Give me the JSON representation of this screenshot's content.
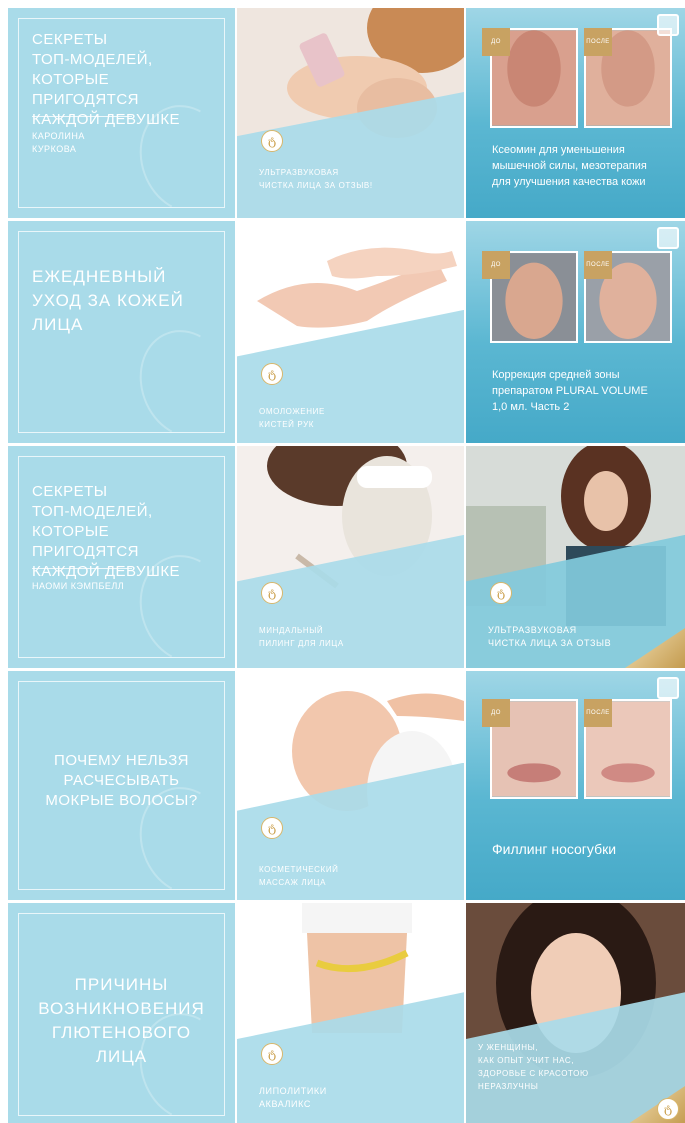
{
  "tiles": {
    "t00": {
      "headline_lines": [
        "СЕКРЕТЫ",
        "ТОП-МОДЕЛЕЙ,",
        "КОТОРЫЕ ПРИГОДЯТСЯ",
        "КАЖДОЙ ДЕВУШКЕ"
      ],
      "caption_lines": [
        "КАРОЛИНА",
        "КУРКОВА"
      ]
    },
    "t01": {
      "caption_lines": [
        "УЛЬТРАЗВУКОВАЯ",
        "ЧИСТКА ЛИЦА ЗА ОТЗЫВ!"
      ]
    },
    "t02": {
      "before": "ДО",
      "after": "ПОСЛЕ",
      "text_lines": [
        "Ксеомин для уменьшения",
        "мышечной силы, мезотерапия",
        "для улучшения качества кожи"
      ]
    },
    "t10": {
      "headline_lines": [
        "ЕЖЕДНЕВНЫЙ",
        "УХОД ЗА КОЖЕЙ",
        "ЛИЦА"
      ]
    },
    "t11": {
      "caption_lines": [
        "ОМОЛОЖЕНИЕ",
        "КИСТЕЙ РУК"
      ]
    },
    "t12": {
      "before": "ДО",
      "after": "ПОСЛЕ",
      "text_lines": [
        "Коррекция средней зоны",
        "препаратом PLURAL VOLUME",
        "1,0 мл. Часть 2"
      ]
    },
    "t20": {
      "headline_lines": [
        "СЕКРЕТЫ",
        "ТОП-МОДЕЛЕЙ,",
        "КОТОРЫЕ ПРИГОДЯТСЯ",
        "КАЖДОЙ ДЕВУШКЕ"
      ],
      "caption_lines": [
        "НАОМИ КЭМПБЕЛЛ"
      ]
    },
    "t21": {
      "caption_lines": [
        "МИНДАЛЬНЫЙ",
        "ПИЛИНГ ДЛЯ ЛИЦА"
      ]
    },
    "t22": {
      "caption_lines": [
        "УЛЬТРАЗВУКОВАЯ",
        "ЧИСТКА ЛИЦА ЗА ОТЗЫВ"
      ]
    },
    "t30": {
      "headline_lines": [
        "ПОЧЕМУ НЕЛЬЗЯ",
        "РАСЧЕСЫВАТЬ",
        "МОКРЫЕ ВОЛОСЫ?"
      ]
    },
    "t31": {
      "caption_lines": [
        "КОСМЕТИЧЕСКИЙ",
        "МАССАЖ ЛИЦА"
      ]
    },
    "t32": {
      "before": "ДО",
      "after": "ПОСЛЕ",
      "text_lines": [
        "Филлинг носогубки"
      ]
    },
    "t40": {
      "headline_lines": [
        "ПРИЧИНЫ",
        "ВОЗНИКНОВЕНИЯ",
        "ГЛЮТЕНОВОГО",
        "ЛИЦА"
      ]
    },
    "t41": {
      "caption_lines": [
        "ЛИПОЛИТИКИ",
        "АКВАЛИКС"
      ]
    },
    "t42": {
      "caption_lines": [
        "У ЖЕНЩИНЫ,",
        "КАК ОПЫТ УЧИТ НАС,",
        "ЗДОРОВЬЕ С КРАСОТОЮ",
        "НЕРАЗЛУЧНЫ"
      ]
    }
  },
  "brand": {
    "logo_glyph": "ტ"
  },
  "colors": {
    "tile_blue": "#a9dbe9",
    "gold": "#c8a262",
    "white": "#ffffff"
  }
}
